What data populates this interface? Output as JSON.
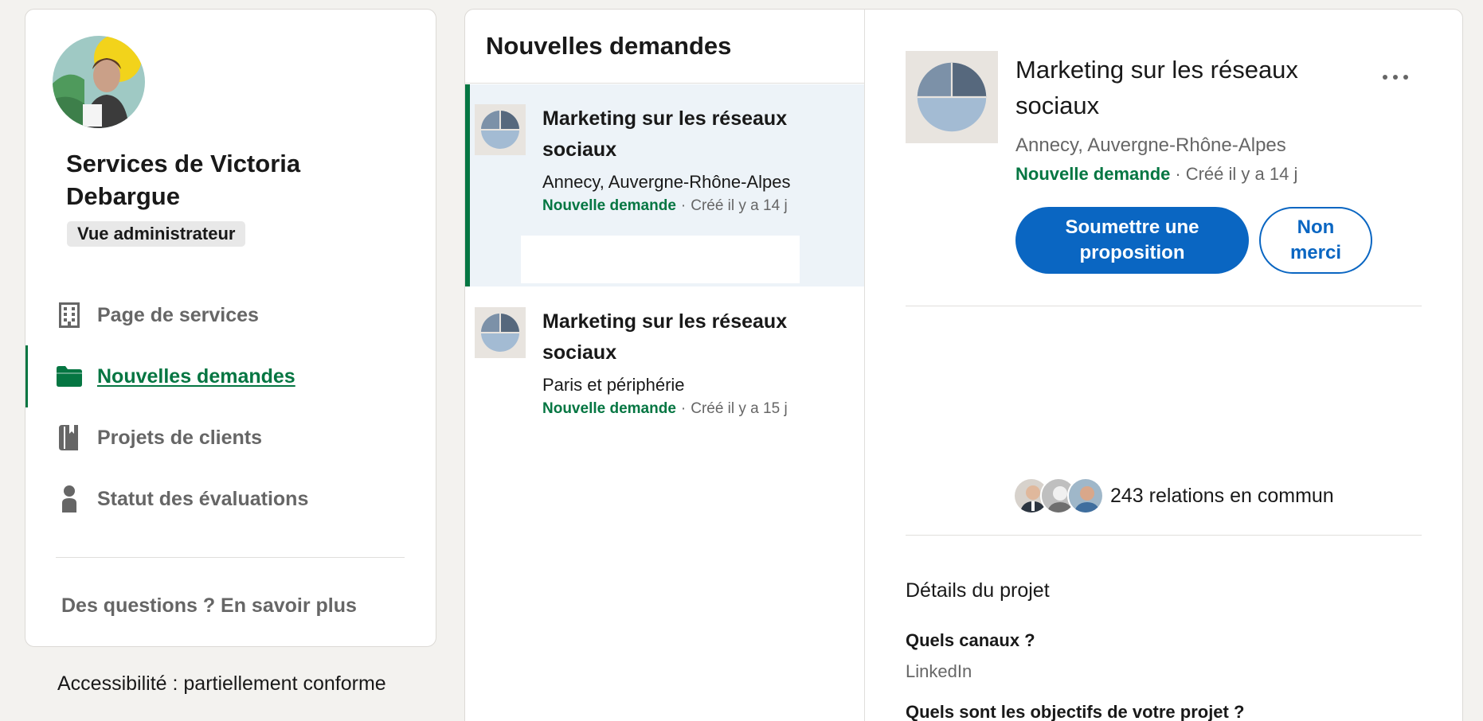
{
  "sidebar": {
    "provider_name": "Services de Victoria Debargue",
    "admin_badge": "Vue administrateur",
    "nav": [
      {
        "label": "Page de services",
        "icon": "building-icon",
        "active": false
      },
      {
        "label": "Nouvelles demandes",
        "icon": "folder-icon",
        "active": true
      },
      {
        "label": "Projets de clients",
        "icon": "book-icon",
        "active": false
      },
      {
        "label": "Statut des évaluations",
        "icon": "person-icon",
        "active": false
      }
    ],
    "help_link": "Des questions ? En savoir plus"
  },
  "footer": {
    "accessibility": "Accessibilité : partiellement conforme"
  },
  "list": {
    "title": "Nouvelles demandes",
    "items": [
      {
        "title": "Marketing sur les réseaux sociaux",
        "location": "Annecy, Auvergne-Rhône-Alpes",
        "status": "Nouvelle demande",
        "separator": "·",
        "created": "Créé il y a 14 j",
        "selected": true
      },
      {
        "title": "Marketing sur les réseaux sociaux",
        "location": "Paris et périphérie",
        "status": "Nouvelle demande",
        "separator": "·",
        "created": "Créé il y a 15 j",
        "selected": false
      }
    ]
  },
  "detail": {
    "title": "Marketing sur les réseaux sociaux",
    "location": "Annecy, Auvergne-Rhône-Alpes",
    "status": "Nouvelle demande",
    "separator": "·",
    "created": "Créé il y a 14 j",
    "submit_label": "Soumettre une proposition",
    "decline_label": "Non merci",
    "mutual_connections": "243 relations en commun",
    "section_title": "Détails du projet",
    "questions": [
      {
        "label": "Quels canaux ?",
        "answer": "LinkedIn"
      },
      {
        "label": "Quels sont les objectifs de votre projet ?",
        "answer": ""
      }
    ]
  },
  "colors": {
    "accent_green": "#057642",
    "primary_blue": "#0a66c2",
    "selected_bg": "#edf3f8",
    "page_bg": "#f3f2ef"
  }
}
